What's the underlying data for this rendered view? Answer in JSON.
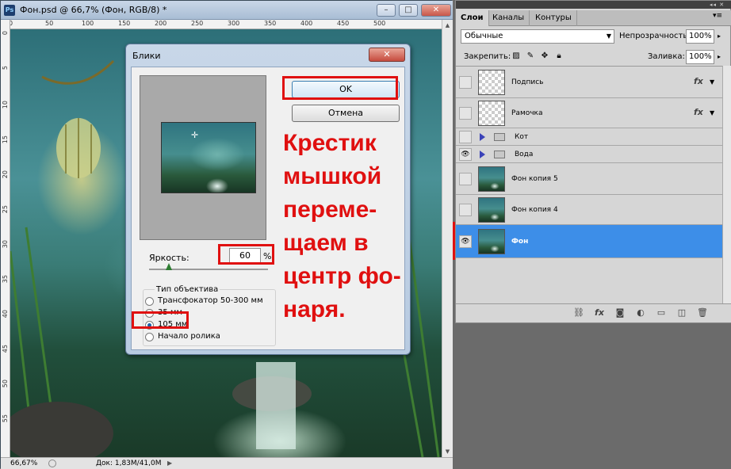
{
  "document": {
    "title": "Фон.psd @ 66,7% (Фон, RGB/8) *",
    "app_icon": "Ps",
    "ruler_ticks": [
      "0",
      "50",
      "100",
      "150",
      "200",
      "250",
      "300",
      "350",
      "400",
      "450",
      "500"
    ],
    "ruler_left_ticks": [
      "0",
      "5",
      "10",
      "15",
      "20",
      "25",
      "30",
      "35",
      "40",
      "45",
      "50",
      "55"
    ],
    "status_zoom": "66,67%",
    "status_doc": "Док: 1,83M/41,0M",
    "minimize_icon": "minimize-icon",
    "maximize_icon": "maximize-icon",
    "close_icon": "close-icon"
  },
  "dialog": {
    "title": "Блики",
    "ok_label": "OK",
    "cancel_label": "Отмена",
    "brightness_label": "Яркость:",
    "brightness_value": "60",
    "brightness_unit": "%",
    "brightness_fraction": 0.6,
    "lens_group_title": "Тип объектива",
    "lens_options": [
      {
        "label": "Трансфокатор 50-300 мм",
        "selected": false
      },
      {
        "label": "35 мм",
        "selected": false
      },
      {
        "label": "105 мм",
        "selected": true
      },
      {
        "label": "Начало ролика",
        "selected": false
      }
    ],
    "crosshair_icon": "crosshair-icon"
  },
  "annotation": {
    "text": "Крестик\nмышкой\nпереме-\nщаем в\nцентр фо-\nнаря.",
    "color": "#e01010"
  },
  "layers_panel": {
    "tabs": [
      "Слои",
      "Каналы",
      "Контуры"
    ],
    "active_tab": "Слои",
    "blend_mode": "Обычные",
    "opacity_label": "Непрозрачность:",
    "opacity_value": "100%",
    "lock_label": "Закрепить:",
    "fill_label": "Заливка:",
    "fill_value": "100%",
    "layers": [
      {
        "name": "Подпись",
        "visible": false,
        "type": "transparent",
        "fx": "fx"
      },
      {
        "name": "Рамочка",
        "visible": false,
        "type": "transparent",
        "fx": "fx"
      },
      {
        "name": "Кот",
        "visible": false,
        "type": "group"
      },
      {
        "name": "Вода",
        "visible": true,
        "type": "group"
      },
      {
        "name": "Фон копия 5",
        "visible": false,
        "type": "photo"
      },
      {
        "name": "Фон копия 4",
        "visible": false,
        "type": "photo"
      },
      {
        "name": "Фон",
        "visible": true,
        "type": "photo",
        "selected": true
      }
    ],
    "selected_color": "#3d8ee8",
    "footer_icons": [
      "link-icon",
      "fx-icon",
      "mask-icon",
      "adjustment-icon",
      "group-icon",
      "new-layer-icon",
      "trash-icon"
    ]
  },
  "highlight_color": "#e01010"
}
